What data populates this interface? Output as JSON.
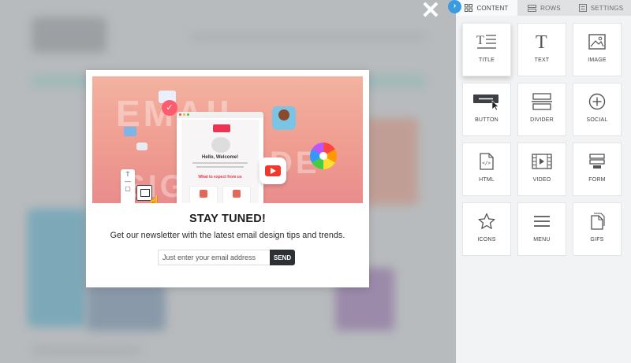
{
  "close": {
    "glyph": "✕"
  },
  "collapse": {
    "glyph": "›"
  },
  "panel": {
    "tabs": [
      {
        "label": "CONTENT",
        "icon": "grid-icon",
        "active": true
      },
      {
        "label": "ROWS",
        "icon": "rows-icon",
        "active": false
      },
      {
        "label": "SETTINGS",
        "icon": "settings-icon",
        "active": false
      }
    ],
    "tiles": [
      {
        "label": "TITLE",
        "icon": "title-icon"
      },
      {
        "label": "TEXT",
        "icon": "text-icon"
      },
      {
        "label": "IMAGE",
        "icon": "image-icon"
      },
      {
        "label": "BUTTON",
        "icon": "button-icon"
      },
      {
        "label": "DIVIDER",
        "icon": "divider-icon"
      },
      {
        "label": "SOCIAL",
        "icon": "social-icon"
      },
      {
        "label": "HTML",
        "icon": "html-icon"
      },
      {
        "label": "VIDEO",
        "icon": "video-icon"
      },
      {
        "label": "FORM",
        "icon": "form-icon"
      },
      {
        "label": "ICONS",
        "icon": "star-icon"
      },
      {
        "label": "MENU",
        "icon": "menu-icon"
      },
      {
        "label": "GIFS",
        "icon": "gifs-icon"
      }
    ]
  },
  "modal": {
    "hero": {
      "words": [
        "EMAIL",
        "DE",
        "SIGN"
      ],
      "mock_welcome": "Hello, Welcome!",
      "mock_expect": "What to expect from us"
    },
    "title": "STAY TUNED!",
    "subtitle": "Get our newsletter with the latest email design tips and trends.",
    "email_placeholder": "Just enter your email address",
    "send_label": "SEND"
  },
  "colors": {
    "accent": "#3a9ce0",
    "send_bg": "#2d3136",
    "hero_top": "#f3b2a0",
    "hero_bottom": "#e98c8d"
  }
}
